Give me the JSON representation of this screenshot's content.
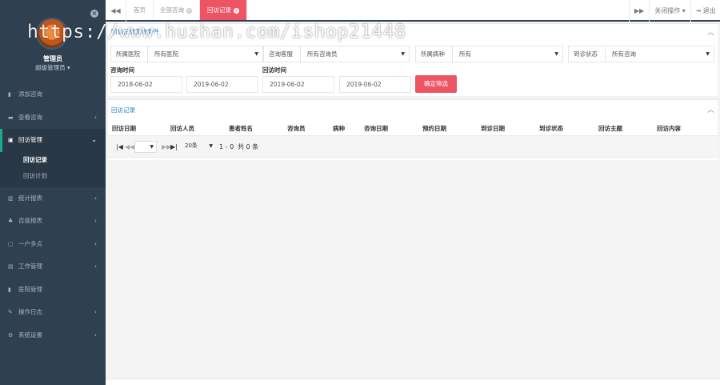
{
  "watermark": "https://www.huzhan.com/ishop21448",
  "sidebar": {
    "close_icon": "×",
    "username": "管理员",
    "role": "超级管理员 ▾",
    "items": [
      {
        "icon": "▮",
        "label": "添加咨询",
        "has_arrow": false
      },
      {
        "icon": "▬",
        "label": "查看咨询",
        "has_arrow": true
      },
      {
        "icon": "▣",
        "label": "回访管理",
        "has_arrow": true,
        "active": true
      },
      {
        "icon": "▥",
        "label": "统计报表",
        "has_arrow": true
      },
      {
        "icon": "♣",
        "label": "百度报表",
        "has_arrow": true
      },
      {
        "icon": "▢",
        "label": "一户多点",
        "has_arrow": true
      },
      {
        "icon": "▤",
        "label": "工作管理",
        "has_arrow": true
      },
      {
        "icon": "▮",
        "label": "医院管理",
        "has_arrow": false
      },
      {
        "icon": "✎",
        "label": "操作日志",
        "has_arrow": true
      },
      {
        "icon": "⚙",
        "label": "系统设置",
        "has_arrow": true
      }
    ],
    "subitems": [
      "回访记录",
      "回访计划"
    ],
    "arrow_right": "‹",
    "arrow_down": "⌄"
  },
  "topbar": {
    "back_icon": "◀◀",
    "forward_icon": "▶▶",
    "tabs": [
      {
        "label": "首页",
        "closable": false,
        "active": false
      },
      {
        "label": "全部咨询",
        "closable": true,
        "active": false
      },
      {
        "label": "回访记录",
        "closable": true,
        "active": true
      }
    ],
    "close_action": "关闭操作 ▾",
    "logout": "⇥ 退出"
  },
  "filter": {
    "title": "回访记录查询条件",
    "collapse_icon": "︿",
    "fields": [
      {
        "label": "所属医院",
        "value": "所有医院"
      },
      {
        "label": "咨询客服",
        "value": "所有咨询员"
      },
      {
        "label": "所属病种",
        "value": "所有"
      },
      {
        "label": "到诊状态",
        "value": "所有咨询"
      }
    ],
    "consult_time_label": "咨询时间",
    "visit_time_label": "回访时间",
    "dates": [
      "2018-06-02",
      "2019-06-02",
      "2019-06-02",
      "2019-06-02"
    ],
    "confirm_label": "确定筛选"
  },
  "records": {
    "title": "回访记录",
    "collapse_icon": "︿",
    "columns": [
      "回访日期",
      "回访人员",
      "患者姓名",
      "咨询员",
      "病种",
      "咨询日期",
      "预约日期",
      "到诊日期",
      "到诊状态",
      "回访主题",
      "回访内容"
    ],
    "pager": {
      "first_icon": "|◀",
      "prev_icon": "◀◀",
      "next_icon": "▶▶",
      "last_icon": "▶|",
      "page_select": "",
      "page_size": "20条",
      "range": "1 - 0",
      "total": "共 0 条"
    }
  }
}
